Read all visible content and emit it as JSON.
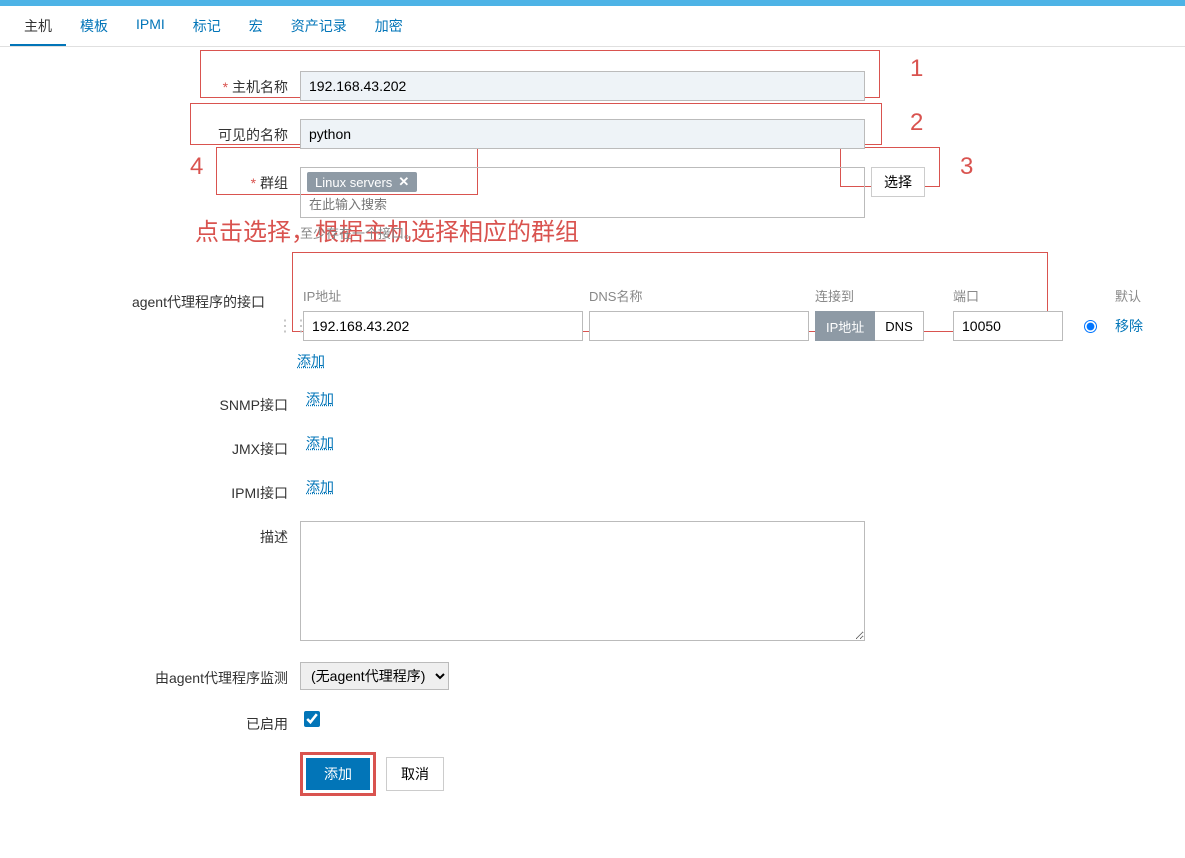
{
  "tabs": {
    "host": "主机",
    "template": "模板",
    "ipmi": "IPMI",
    "tag": "标记",
    "macro": "宏",
    "inventory": "资产记录",
    "encryption": "加密"
  },
  "labels": {
    "hostname": "主机名称",
    "visiblename": "可见的名称",
    "groups": "群组",
    "agent_iface": "agent代理程序的接口",
    "snmp_iface": "SNMP接口",
    "jmx_iface": "JMX接口",
    "ipmi_iface": "IPMI接口",
    "description": "描述",
    "monitored_by": "由agent代理程序监测",
    "enabled": "已启用"
  },
  "fields": {
    "hostname_value": "192.168.43.202",
    "visiblename_value": "python",
    "group_tag": "Linux servers",
    "group_placeholder": "在此输入搜索",
    "select_btn": "选择",
    "proxy_value": "(无agent代理程序)"
  },
  "iface_headers": {
    "ip": "IP地址",
    "dns": "DNS名称",
    "connect": "连接到",
    "port": "端口",
    "default": "默认"
  },
  "agent_row": {
    "ip": "192.168.43.202",
    "dns": "",
    "connect_ip": "IP地址",
    "connect_dns": "DNS",
    "port": "10050",
    "remove": "移除"
  },
  "links": {
    "add": "添加"
  },
  "actions": {
    "submit": "添加",
    "cancel": "取消"
  },
  "annotations": {
    "n1": "1",
    "n2": "2",
    "n3": "3",
    "n4": "4",
    "text_hint": "点击选择，根据主机选择相应的群组",
    "grey_hint": "至少存在一个接口。"
  }
}
